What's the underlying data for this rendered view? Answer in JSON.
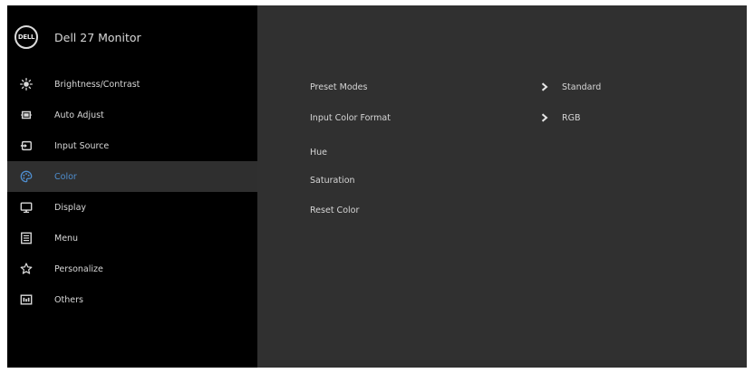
{
  "header": {
    "logo_text": "DELL",
    "title": "Dell 27 Monitor"
  },
  "sidebar": {
    "items": [
      {
        "label": "Brightness/Contrast",
        "icon": "brightness-icon"
      },
      {
        "label": "Auto Adjust",
        "icon": "auto-adjust-icon"
      },
      {
        "label": "Input Source",
        "icon": "input-source-icon"
      },
      {
        "label": "Color",
        "icon": "color-palette-icon",
        "active": true
      },
      {
        "label": "Display",
        "icon": "display-icon"
      },
      {
        "label": "Menu",
        "icon": "menu-icon"
      },
      {
        "label": "Personalize",
        "icon": "star-icon"
      },
      {
        "label": "Others",
        "icon": "others-icon"
      }
    ]
  },
  "panel": {
    "rows": [
      {
        "label": "Preset Modes",
        "value": "Standard"
      },
      {
        "label": "Input Color Format",
        "value": "RGB"
      },
      {
        "label": "Hue",
        "value": ""
      },
      {
        "label": "Saturation",
        "value": ""
      },
      {
        "label": "Reset Color",
        "value": ""
      }
    ]
  },
  "colors": {
    "sidebar_bg": "#000000",
    "panel_bg": "#303030",
    "active_bg": "#2f2f2f",
    "active_text": "#4f8ecf",
    "text": "#d8d8d8"
  }
}
